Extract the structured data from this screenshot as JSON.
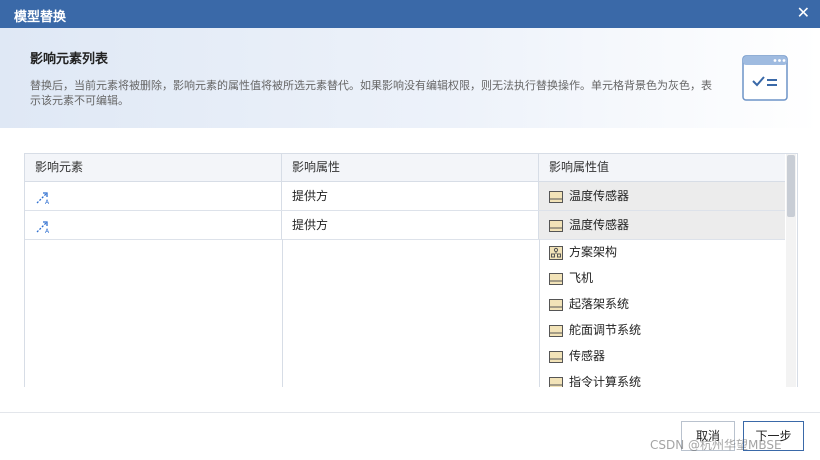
{
  "dialog": {
    "title": "模型替换",
    "close_icon": "close-icon"
  },
  "header": {
    "heading": "影响元素列表",
    "description": "替换后，当前元素将被删除，影响元素的属性值将被所选元素替代。如果影响没有编辑权限，则无法执行替换操作。单元格背景色为灰色，表示该元素不可编辑。",
    "icon": "checklist-window-icon"
  },
  "table": {
    "columns": [
      "影响元素",
      "影响属性",
      "影响属性值"
    ],
    "rows": [
      {
        "element_icon": "association-icon",
        "property": "提供方",
        "value": "温度传感器",
        "value_icon": "block-icon"
      },
      {
        "element_icon": "association-icon",
        "property": "提供方",
        "value": "温度传感器",
        "value_icon": "block-icon"
      }
    ],
    "options": [
      {
        "label": "方案架构",
        "icon": "package-icon"
      },
      {
        "label": "飞机",
        "icon": "block-icon"
      },
      {
        "label": "起落架系统",
        "icon": "block-icon"
      },
      {
        "label": "舵面调节系统",
        "icon": "block-icon"
      },
      {
        "label": "传感器",
        "icon": "block-icon"
      },
      {
        "label": "指令计算系统",
        "icon": "block-icon"
      }
    ]
  },
  "footer": {
    "cancel_label": "取消",
    "next_label": "下一步",
    "watermark": "CSDN @杭州华望MBSE"
  },
  "colors": {
    "titlebar": "#3a69a8",
    "readonly_cell": "#ececec",
    "header_gradient_start": "#dfe8f5"
  }
}
